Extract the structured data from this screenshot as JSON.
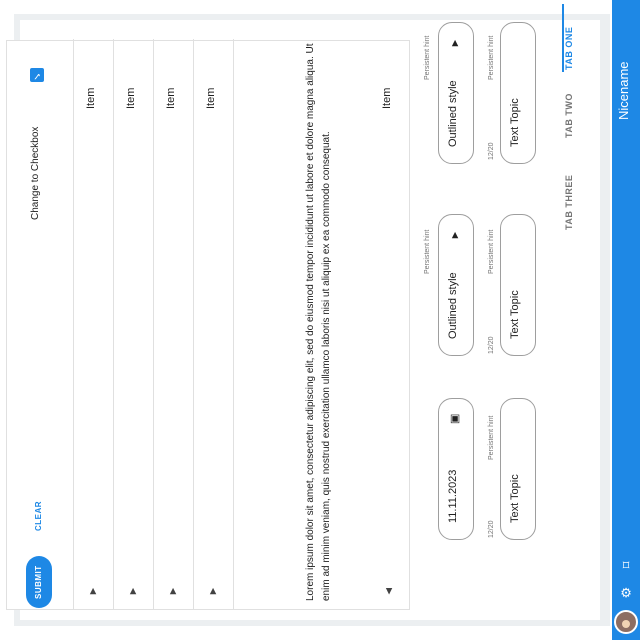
{
  "app": {
    "title": "Nicename"
  },
  "tabs": [
    {
      "label": "TAB ONE",
      "active": true
    },
    {
      "label": "TAB TWO",
      "active": false
    },
    {
      "label": "TAB THREE",
      "active": false
    }
  ],
  "fields": {
    "text1": {
      "value": "Text Topic",
      "helper": "Persistent hint",
      "counter": "12/20"
    },
    "text2": {
      "value": "Text Topic",
      "helper": "Persistent hint",
      "counter": "12/20"
    },
    "text3": {
      "value": "Text Topic",
      "helper": "Persistent hint",
      "counter": "12/20"
    },
    "select1": {
      "value": "Outlined style",
      "helper": "Persistent hint"
    },
    "select2": {
      "value": "Outlined style",
      "helper": "Persistent hint"
    },
    "date": {
      "value": "11.11.2023"
    }
  },
  "accordion": {
    "items": [
      {
        "title": "Item",
        "expanded": true
      },
      {
        "title": "Item",
        "expanded": false
      },
      {
        "title": "Item",
        "expanded": false
      },
      {
        "title": "Item",
        "expanded": false
      },
      {
        "title": "Item",
        "expanded": false
      }
    ],
    "body": "Lorem ipsum dolor sit amet, consectetur adipiscing elit, sed do eiusmod tempor incididunt ut labore et dolore magna aliqua. Ut enim ad minim veniam, quis nostrud exercitation ullamco laboris nisi ut aliquip ex ea commodo consequat."
  },
  "checkbox": {
    "label": "Change to Checkbox",
    "checked": true
  },
  "buttons": {
    "submit": "SUBMIT",
    "clear": "CLEAR"
  },
  "colors": {
    "primary": "#1e88e5"
  }
}
